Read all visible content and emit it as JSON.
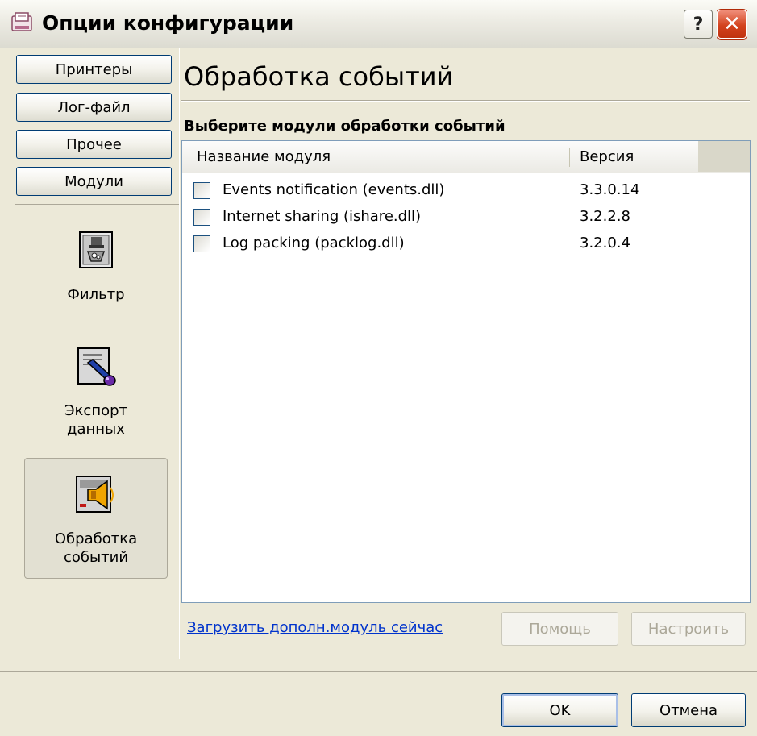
{
  "window": {
    "title": "Опции конфигурации",
    "help_label": "?",
    "close_label": "✕"
  },
  "nav": {
    "buttons": [
      {
        "label": "Принтеры"
      },
      {
        "label": "Лог-файл"
      },
      {
        "label": "Прочее"
      },
      {
        "label": "Модули"
      }
    ],
    "tools": [
      {
        "label_line1": "Фильтр",
        "label_line2": "",
        "icon": "filter-icon",
        "active": false
      },
      {
        "label_line1": "Экспорт",
        "label_line2": "данных",
        "icon": "data-export-icon",
        "active": false
      },
      {
        "label_line1": "Обработка",
        "label_line2": "событий",
        "icon": "event-handling-icon",
        "active": true
      }
    ]
  },
  "main": {
    "section_title": "Обработка событий",
    "group_label": "Выберите модули обработки событий",
    "columns": {
      "name": "Название модуля",
      "version": "Версия"
    },
    "modules": [
      {
        "name": "Events notification (events.dll)",
        "version": "3.3.0.14",
        "checked": false
      },
      {
        "name": "Internet sharing (ishare.dll)",
        "version": "3.2.2.8",
        "checked": false
      },
      {
        "name": "Log packing (packlog.dll)",
        "version": "3.2.0.4",
        "checked": false
      }
    ],
    "load_link": "Загрузить дополн.модуль сейчас",
    "help_button": "Помощь",
    "configure_button": "Настроить"
  },
  "footer": {
    "ok_button": "OK",
    "cancel_button": "Отмена"
  },
  "colors": {
    "face": "#ece9d8",
    "border_blue": "#003c74",
    "link": "#0033cc",
    "close_red": "#d3431e"
  }
}
